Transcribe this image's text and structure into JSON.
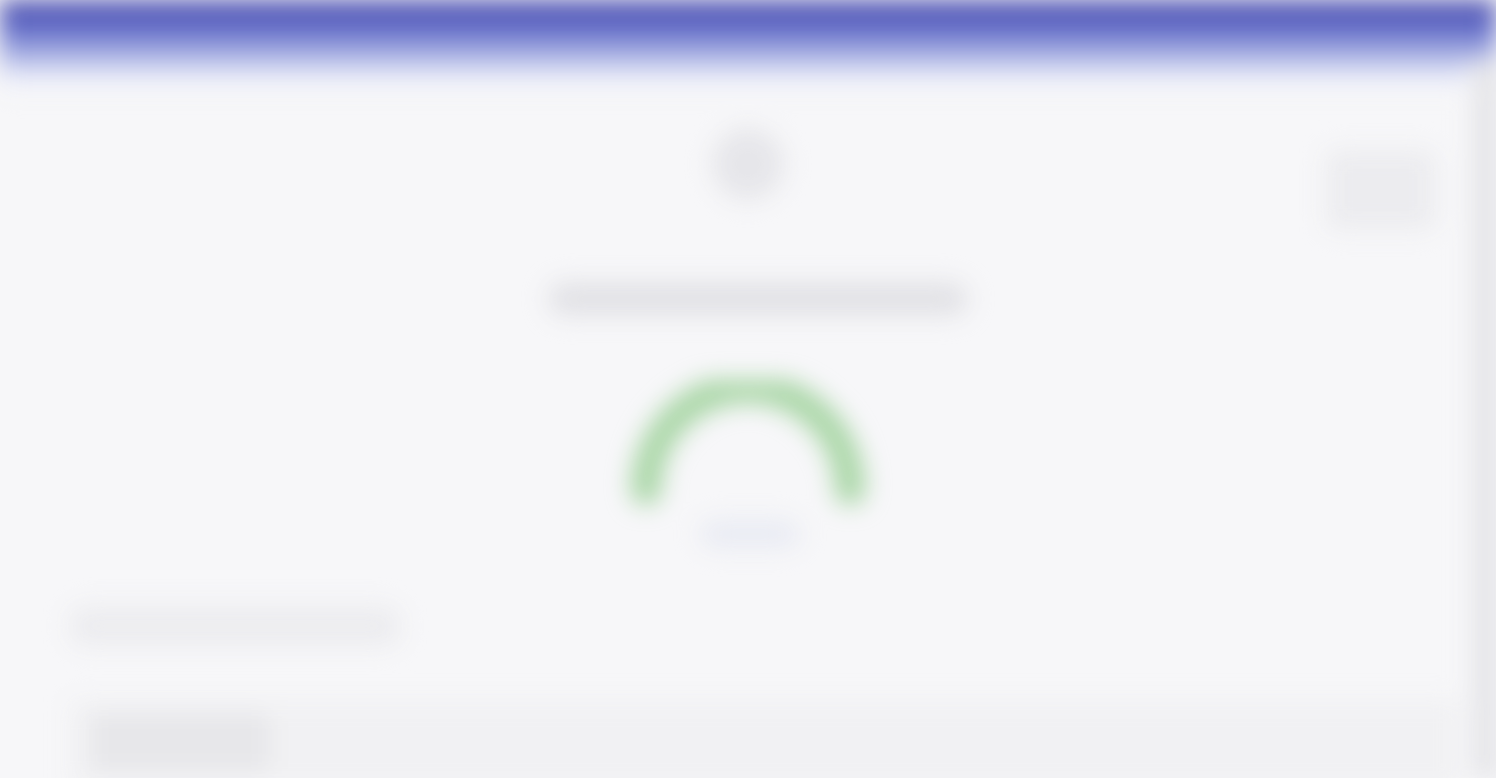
{
  "header": {
    "accent_color": "#4a4aa8"
  },
  "main": {
    "icon": "profile-icon",
    "title": "",
    "gauge": {
      "color": "#a9d6a6",
      "label": ""
    },
    "section_label": ""
  },
  "colors": {
    "background": "#f7f7f9",
    "gauge_green": "#a9d6a6"
  }
}
